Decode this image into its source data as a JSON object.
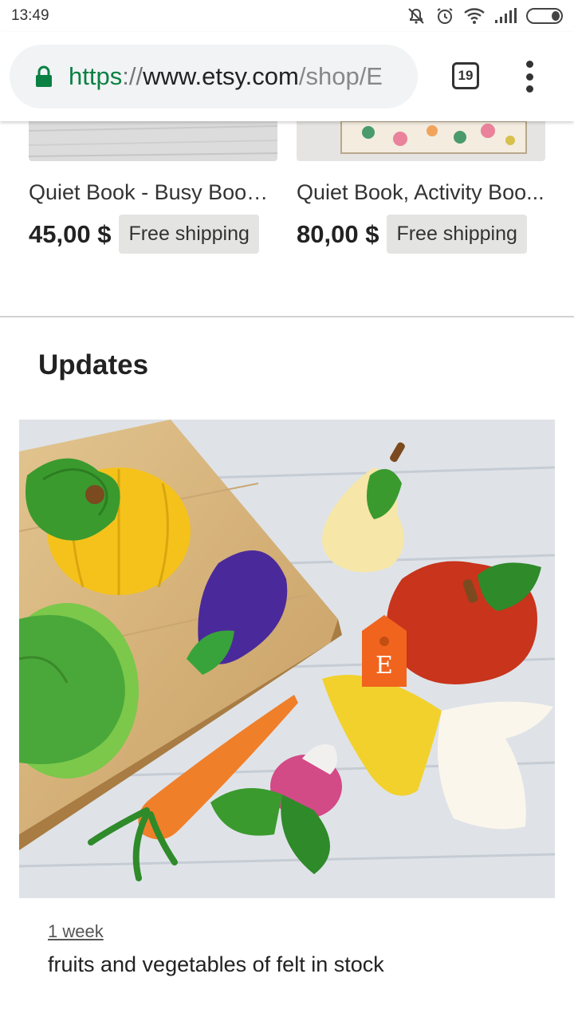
{
  "status_bar": {
    "time": "13:49",
    "icons": [
      "mute-icon",
      "alarm-icon",
      "wifi-icon",
      "signal-icon",
      "battery-icon"
    ]
  },
  "browser": {
    "url_scheme": "https",
    "url_separator": "://",
    "url_host": "www.etsy.com",
    "url_path": "/shop/E",
    "tab_count": "19",
    "secure_color": "#0b8043"
  },
  "listings": [
    {
      "title": "Quiet Book - Busy Book ...",
      "price": "45,00 $",
      "shipping": "Free shipping"
    },
    {
      "title": "Quiet Book, Activity Boo...",
      "price": "80,00 $",
      "shipping": "Free shipping"
    }
  ],
  "updates": {
    "heading": "Updates",
    "time_ago": "1 week",
    "text": "fruits and vegetables of felt in stock",
    "badge_letter": "E",
    "badge_color": "#f1641e"
  }
}
